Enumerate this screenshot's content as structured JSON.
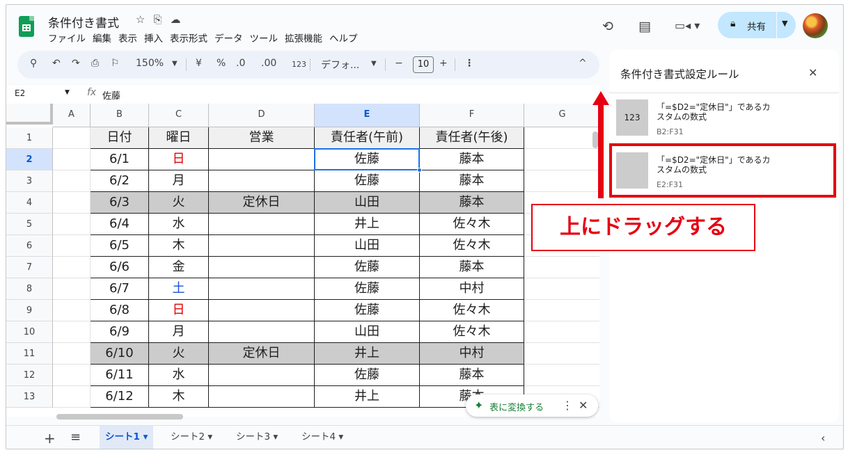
{
  "app": {
    "title": "条件付き書式",
    "title_icons": [
      "☆",
      "⎘",
      "☁"
    ],
    "menu": [
      "ファイル",
      "編集",
      "表示",
      "挿入",
      "表示形式",
      "データ",
      "ツール",
      "拡張機能",
      "ヘルプ"
    ],
    "header_icons": [
      "history-icon",
      "comment-icon",
      "video-icon"
    ],
    "share_label": "共有"
  },
  "toolbar": {
    "zoom": "150%",
    "currency": "¥",
    "percent": "%",
    "dec_decrease": ".0",
    "dec_increase": ".00",
    "number_format": "123",
    "font": "デフォ...",
    "font_size": "10",
    "minus": "−",
    "plus": "+"
  },
  "formula_bar": {
    "cell_ref": "E2",
    "fx": "fx",
    "value": "佐藤"
  },
  "grid": {
    "columns": [
      "A",
      "B",
      "C",
      "D",
      "E",
      "F",
      "G"
    ],
    "selected_col": "E",
    "rows": [
      {
        "num": "1",
        "b": "日付",
        "c": "曜日",
        "d": "営業",
        "e": "責任者(午前)",
        "f": "責任者(午後)"
      },
      {
        "num": "2",
        "b": "6/1",
        "c": "日",
        "d": "",
        "e": "佐藤",
        "f": "藤本"
      },
      {
        "num": "3",
        "b": "6/2",
        "c": "月",
        "d": "",
        "e": "佐藤",
        "f": "藤本"
      },
      {
        "num": "4",
        "b": "6/3",
        "c": "火",
        "d": "定休日",
        "e": "山田",
        "f": "藤本"
      },
      {
        "num": "5",
        "b": "6/4",
        "c": "水",
        "d": "",
        "e": "井上",
        "f": "佐々木"
      },
      {
        "num": "6",
        "b": "6/5",
        "c": "木",
        "d": "",
        "e": "山田",
        "f": "佐々木"
      },
      {
        "num": "7",
        "b": "6/6",
        "c": "金",
        "d": "",
        "e": "佐藤",
        "f": "藤本"
      },
      {
        "num": "8",
        "b": "6/7",
        "c": "土",
        "d": "",
        "e": "佐藤",
        "f": "中村"
      },
      {
        "num": "9",
        "b": "6/8",
        "c": "日",
        "d": "",
        "e": "佐藤",
        "f": "佐々木"
      },
      {
        "num": "10",
        "b": "6/9",
        "c": "月",
        "d": "",
        "e": "山田",
        "f": "佐々木"
      },
      {
        "num": "11",
        "b": "6/10",
        "c": "火",
        "d": "定休日",
        "e": "井上",
        "f": "中村"
      },
      {
        "num": "12",
        "b": "6/11",
        "c": "水",
        "d": "",
        "e": "佐藤",
        "f": "藤本"
      },
      {
        "num": "13",
        "b": "6/12",
        "c": "木",
        "d": "",
        "e": "井上",
        "f": "藤本"
      }
    ],
    "colors": {
      "sunday": "#e00000",
      "saturday": "#1a4fd6",
      "holiday_fill": "#cccccc"
    }
  },
  "convert_chip": {
    "label": "表に変換する"
  },
  "sheet_tabs": [
    "シート1",
    "シート2",
    "シート3",
    "シート4"
  ],
  "panel": {
    "title": "条件付き書式設定ルール",
    "rules": [
      {
        "preview": "123",
        "text": "「=$D2=\"定休日\"」であるカスタムの数式",
        "range": "B2:F31"
      },
      {
        "preview": "",
        "text": "「=$D2=\"定休日\"」であるカスタムの数式",
        "range": "E2:F31"
      }
    ]
  },
  "annotation": {
    "label": "上にドラッグする",
    "color": "#e60012"
  }
}
